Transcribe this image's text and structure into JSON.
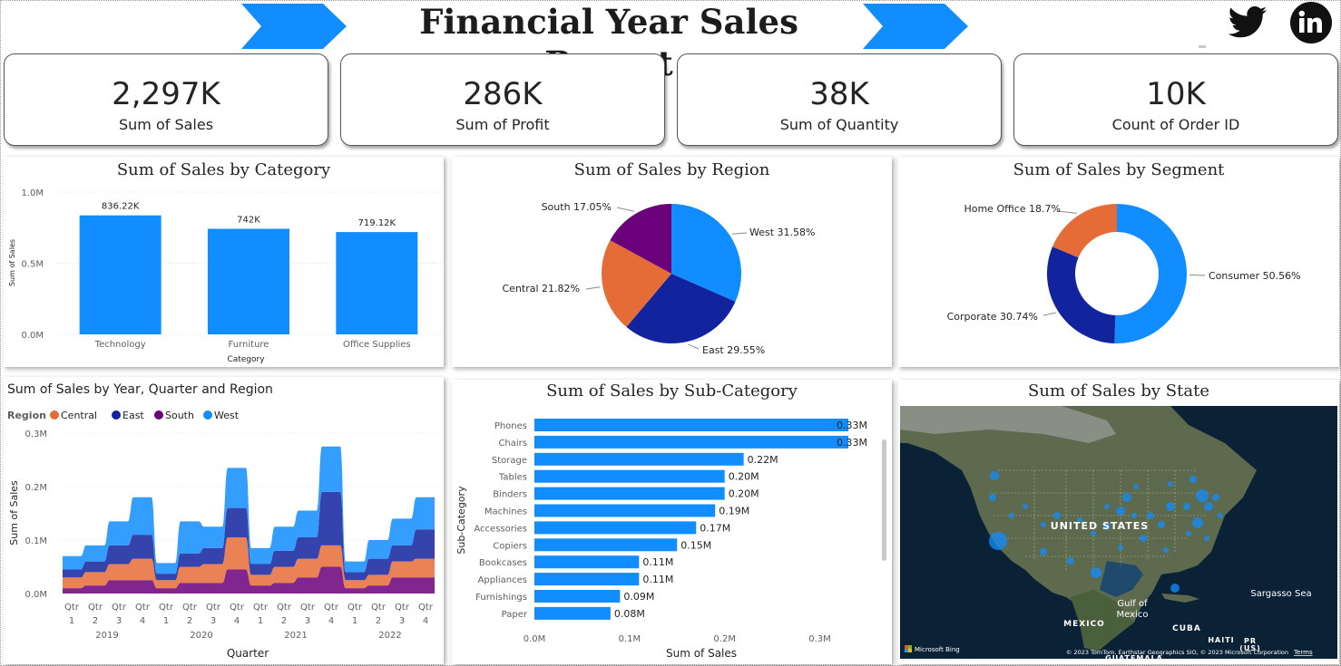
{
  "header": {
    "title": "Financial Year Sales Report",
    "social": [
      {
        "icon": "twitter-icon"
      },
      {
        "icon": "linkedin-icon"
      }
    ]
  },
  "kpis": [
    {
      "value": "2,297K",
      "label": "Sum of Sales"
    },
    {
      "value": "286K",
      "label": "Sum of Profit"
    },
    {
      "value": "38K",
      "label": "Sum of Quantity"
    },
    {
      "value": "10K",
      "label": "Count of Order ID"
    }
  ],
  "colors": {
    "accent": "#118DFF",
    "central": "#E66C37",
    "east": "#12239E",
    "south": "#6B007B",
    "west": "#118DFF"
  },
  "panels": {
    "category": "Sum of Sales by Category",
    "region": "Sum of Sales by Region",
    "segment": "Sum of Sales by Segment",
    "trend": "Sum of Sales by Year, Quarter and Region",
    "subcategory": "Sum of Sales by Sub-Category",
    "state": "Sum of Sales by State"
  },
  "chart_data": [
    {
      "type": "bar",
      "title": "Sum of Sales by Category",
      "categories": [
        "Technology",
        "Furniture",
        "Office Supplies"
      ],
      "values": [
        836220,
        742000,
        719120
      ],
      "data_labels": [
        "836.22K",
        "742K",
        "719.12K"
      ],
      "xlabel": "Category",
      "ylabel": "Sum of Sales",
      "ylim": [
        0,
        1000000
      ],
      "yticks": [
        "0.0M",
        "0.5M",
        "1.0M"
      ],
      "grid": true
    },
    {
      "type": "pie",
      "title": "Sum of Sales by Region",
      "slices": [
        {
          "name": "West",
          "value": 31.58,
          "label": "West 31.58%"
        },
        {
          "name": "East",
          "value": 29.55,
          "label": "East 29.55%"
        },
        {
          "name": "Central",
          "value": 21.82,
          "label": "Central 21.82%"
        },
        {
          "name": "South",
          "value": 17.05,
          "label": "South 17.05%"
        }
      ]
    },
    {
      "type": "pie",
      "title": "Sum of Sales by Segment",
      "donut": true,
      "slices": [
        {
          "name": "Consumer",
          "value": 50.56,
          "label": "Consumer 50.56%"
        },
        {
          "name": "Corporate",
          "value": 30.74,
          "label": "Corporate 30.74%"
        },
        {
          "name": "Home Office",
          "value": 18.7,
          "label": "Home Office 18.7%"
        }
      ]
    },
    {
      "type": "area",
      "title": "Sum of Sales by Year, Quarter and Region",
      "legend_title": "Region",
      "legend_position": "top-left",
      "categories": [
        "Qtr 1",
        "Qtr 2",
        "Qtr 3",
        "Qtr 4",
        "Qtr 1",
        "Qtr 2",
        "Qtr 3",
        "Qtr 4",
        "Qtr 1",
        "Qtr 2",
        "Qtr 3",
        "Qtr 4",
        "Qtr 1",
        "Qtr 2",
        "Qtr 3",
        "Qtr 4"
      ],
      "years": [
        "2019",
        "2020",
        "2021",
        "2022"
      ],
      "series": [
        {
          "name": "Central",
          "values": [
            0.02,
            0.025,
            0.03,
            0.04,
            0.015,
            0.03,
            0.035,
            0.06,
            0.02,
            0.03,
            0.035,
            0.04,
            0.015,
            0.02,
            0.03,
            0.035
          ]
        },
        {
          "name": "East",
          "values": [
            0.015,
            0.02,
            0.035,
            0.045,
            0.012,
            0.025,
            0.03,
            0.055,
            0.02,
            0.03,
            0.04,
            0.1,
            0.015,
            0.03,
            0.03,
            0.055
          ]
        },
        {
          "name": "South",
          "values": [
            0.01,
            0.015,
            0.025,
            0.025,
            0.01,
            0.02,
            0.02,
            0.045,
            0.015,
            0.02,
            0.03,
            0.05,
            0.01,
            0.015,
            0.03,
            0.03
          ]
        },
        {
          "name": "West",
          "values": [
            0.025,
            0.03,
            0.045,
            0.07,
            0.02,
            0.06,
            0.04,
            0.075,
            0.03,
            0.045,
            0.05,
            0.085,
            0.02,
            0.035,
            0.05,
            0.06
          ]
        }
      ],
      "xlabel": "Quarter",
      "ylabel": "Sum of Sales",
      "ylim": [
        0,
        0.3
      ],
      "yticks": [
        "0.0M",
        "0.1M",
        "0.2M",
        "0.3M"
      ]
    },
    {
      "type": "bar",
      "orientation": "horizontal",
      "title": "Sum of Sales by Sub-Category",
      "categories": [
        "Phones",
        "Chairs",
        "Storage",
        "Tables",
        "Binders",
        "Machines",
        "Accessories",
        "Copiers",
        "Bookcases",
        "Appliances",
        "Furnishings",
        "Paper"
      ],
      "values": [
        0.33,
        0.33,
        0.22,
        0.2,
        0.2,
        0.19,
        0.17,
        0.15,
        0.11,
        0.11,
        0.09,
        0.08
      ],
      "data_labels": [
        "0.33M",
        "0.33M",
        "0.22M",
        "0.20M",
        "0.20M",
        "0.19M",
        "0.17M",
        "0.15M",
        "0.11M",
        "0.11M",
        "0.09M",
        "0.08M"
      ],
      "xlabel": "Sum of Sales",
      "ylabel": "Sub-Category",
      "xlim": [
        0,
        0.33
      ],
      "xticks": [
        "0.0M",
        "0.1M",
        "0.2M",
        "0.3M"
      ]
    }
  ],
  "map": {
    "labels": [
      "UNITED STATES",
      "Gulf of Mexico",
      "MEXICO",
      "CUBA",
      "HAITI",
      "PR (US)",
      "Sargasso Sea",
      "GUATEMALA"
    ],
    "attribution": "© 2023 TomTom, Earthstar Geographics SIO, © 2023 Microsoft Corporation",
    "terms": "Terms",
    "logo": "Microsoft Bing"
  }
}
